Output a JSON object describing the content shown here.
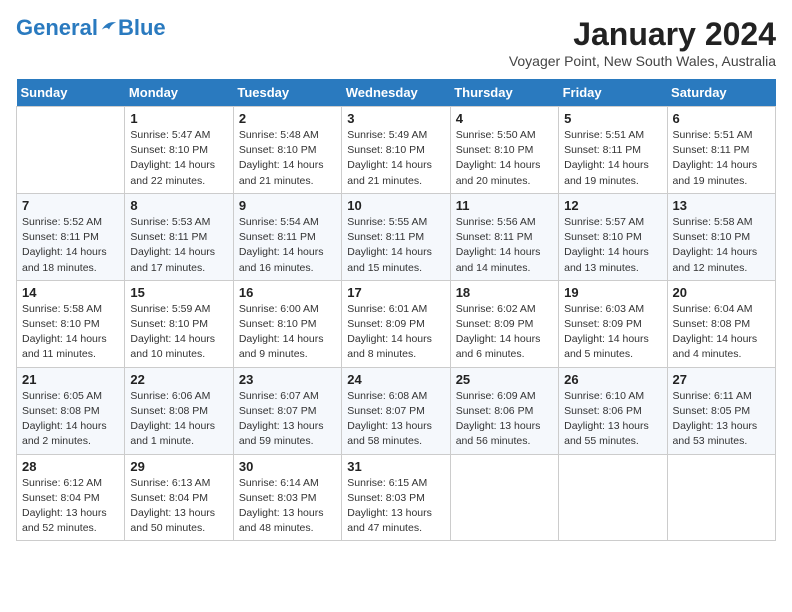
{
  "header": {
    "logo_line1": "General",
    "logo_line2": "Blue",
    "month": "January 2024",
    "location": "Voyager Point, New South Wales, Australia"
  },
  "days_of_week": [
    "Sunday",
    "Monday",
    "Tuesday",
    "Wednesday",
    "Thursday",
    "Friday",
    "Saturday"
  ],
  "weeks": [
    [
      {
        "day": "",
        "info": ""
      },
      {
        "day": "1",
        "info": "Sunrise: 5:47 AM\nSunset: 8:10 PM\nDaylight: 14 hours\nand 22 minutes."
      },
      {
        "day": "2",
        "info": "Sunrise: 5:48 AM\nSunset: 8:10 PM\nDaylight: 14 hours\nand 21 minutes."
      },
      {
        "day": "3",
        "info": "Sunrise: 5:49 AM\nSunset: 8:10 PM\nDaylight: 14 hours\nand 21 minutes."
      },
      {
        "day": "4",
        "info": "Sunrise: 5:50 AM\nSunset: 8:10 PM\nDaylight: 14 hours\nand 20 minutes."
      },
      {
        "day": "5",
        "info": "Sunrise: 5:51 AM\nSunset: 8:11 PM\nDaylight: 14 hours\nand 19 minutes."
      },
      {
        "day": "6",
        "info": "Sunrise: 5:51 AM\nSunset: 8:11 PM\nDaylight: 14 hours\nand 19 minutes."
      }
    ],
    [
      {
        "day": "7",
        "info": "Sunrise: 5:52 AM\nSunset: 8:11 PM\nDaylight: 14 hours\nand 18 minutes."
      },
      {
        "day": "8",
        "info": "Sunrise: 5:53 AM\nSunset: 8:11 PM\nDaylight: 14 hours\nand 17 minutes."
      },
      {
        "day": "9",
        "info": "Sunrise: 5:54 AM\nSunset: 8:11 PM\nDaylight: 14 hours\nand 16 minutes."
      },
      {
        "day": "10",
        "info": "Sunrise: 5:55 AM\nSunset: 8:11 PM\nDaylight: 14 hours\nand 15 minutes."
      },
      {
        "day": "11",
        "info": "Sunrise: 5:56 AM\nSunset: 8:11 PM\nDaylight: 14 hours\nand 14 minutes."
      },
      {
        "day": "12",
        "info": "Sunrise: 5:57 AM\nSunset: 8:10 PM\nDaylight: 14 hours\nand 13 minutes."
      },
      {
        "day": "13",
        "info": "Sunrise: 5:58 AM\nSunset: 8:10 PM\nDaylight: 14 hours\nand 12 minutes."
      }
    ],
    [
      {
        "day": "14",
        "info": "Sunrise: 5:58 AM\nSunset: 8:10 PM\nDaylight: 14 hours\nand 11 minutes."
      },
      {
        "day": "15",
        "info": "Sunrise: 5:59 AM\nSunset: 8:10 PM\nDaylight: 14 hours\nand 10 minutes."
      },
      {
        "day": "16",
        "info": "Sunrise: 6:00 AM\nSunset: 8:10 PM\nDaylight: 14 hours\nand 9 minutes."
      },
      {
        "day": "17",
        "info": "Sunrise: 6:01 AM\nSunset: 8:09 PM\nDaylight: 14 hours\nand 8 minutes."
      },
      {
        "day": "18",
        "info": "Sunrise: 6:02 AM\nSunset: 8:09 PM\nDaylight: 14 hours\nand 6 minutes."
      },
      {
        "day": "19",
        "info": "Sunrise: 6:03 AM\nSunset: 8:09 PM\nDaylight: 14 hours\nand 5 minutes."
      },
      {
        "day": "20",
        "info": "Sunrise: 6:04 AM\nSunset: 8:08 PM\nDaylight: 14 hours\nand 4 minutes."
      }
    ],
    [
      {
        "day": "21",
        "info": "Sunrise: 6:05 AM\nSunset: 8:08 PM\nDaylight: 14 hours\nand 2 minutes."
      },
      {
        "day": "22",
        "info": "Sunrise: 6:06 AM\nSunset: 8:08 PM\nDaylight: 14 hours\nand 1 minute."
      },
      {
        "day": "23",
        "info": "Sunrise: 6:07 AM\nSunset: 8:07 PM\nDaylight: 13 hours\nand 59 minutes."
      },
      {
        "day": "24",
        "info": "Sunrise: 6:08 AM\nSunset: 8:07 PM\nDaylight: 13 hours\nand 58 minutes."
      },
      {
        "day": "25",
        "info": "Sunrise: 6:09 AM\nSunset: 8:06 PM\nDaylight: 13 hours\nand 56 minutes."
      },
      {
        "day": "26",
        "info": "Sunrise: 6:10 AM\nSunset: 8:06 PM\nDaylight: 13 hours\nand 55 minutes."
      },
      {
        "day": "27",
        "info": "Sunrise: 6:11 AM\nSunset: 8:05 PM\nDaylight: 13 hours\nand 53 minutes."
      }
    ],
    [
      {
        "day": "28",
        "info": "Sunrise: 6:12 AM\nSunset: 8:04 PM\nDaylight: 13 hours\nand 52 minutes."
      },
      {
        "day": "29",
        "info": "Sunrise: 6:13 AM\nSunset: 8:04 PM\nDaylight: 13 hours\nand 50 minutes."
      },
      {
        "day": "30",
        "info": "Sunrise: 6:14 AM\nSunset: 8:03 PM\nDaylight: 13 hours\nand 48 minutes."
      },
      {
        "day": "31",
        "info": "Sunrise: 6:15 AM\nSunset: 8:03 PM\nDaylight: 13 hours\nand 47 minutes."
      },
      {
        "day": "",
        "info": ""
      },
      {
        "day": "",
        "info": ""
      },
      {
        "day": "",
        "info": ""
      }
    ]
  ]
}
